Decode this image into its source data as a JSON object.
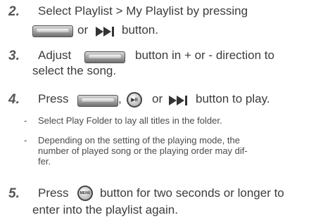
{
  "steps": [
    {
      "number": "2.",
      "lines": [
        "Select Playlist > My Playlist by pressing",
        "or",
        "button."
      ]
    },
    {
      "number": "3.",
      "lines": [
        "Adjust",
        "button in + or - direction to",
        "select the song."
      ]
    },
    {
      "number": "4.",
      "lines": [
        "Press",
        ",",
        "or",
        "button to play."
      ]
    },
    {
      "number": "5.",
      "lines": [
        "Press",
        "button for two seconds or longer to",
        "enter into the playlist again."
      ]
    }
  ],
  "notes": [
    "Select Play Folder to lay all titles in the folder.",
    "Depending on the setting of the playing mode, the",
    "number of played song or the playing order may dif-",
    "fer."
  ],
  "note_dash": "-",
  "icons": {
    "play_pause_label": "▶II",
    "menu_label": "MENU"
  }
}
